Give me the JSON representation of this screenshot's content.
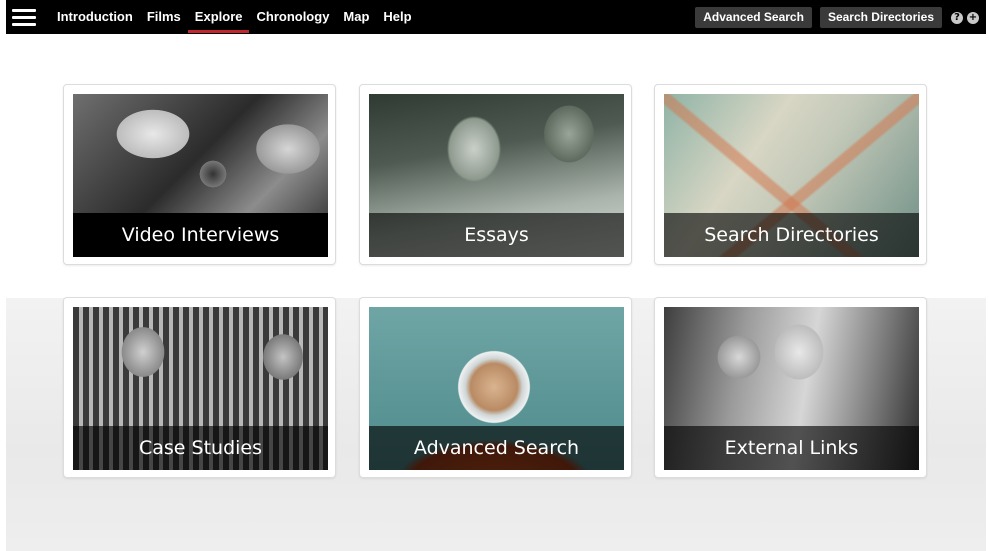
{
  "nav": {
    "menu_icon": "hamburger-menu-icon",
    "links": [
      "Introduction",
      "Films",
      "Explore",
      "Chronology",
      "Map",
      "Help"
    ],
    "active": "Explore",
    "buttons": [
      "Advanced Search",
      "Search Directories"
    ],
    "help_icon": "?",
    "plus_icon": "+"
  },
  "accent_color": "#c1272d",
  "tiles": [
    {
      "label": "Video Interviews"
    },
    {
      "label": "Essays"
    },
    {
      "label": "Search Directories"
    },
    {
      "label": "Case Studies"
    },
    {
      "label": "Advanced Search"
    },
    {
      "label": "External Links"
    }
  ]
}
